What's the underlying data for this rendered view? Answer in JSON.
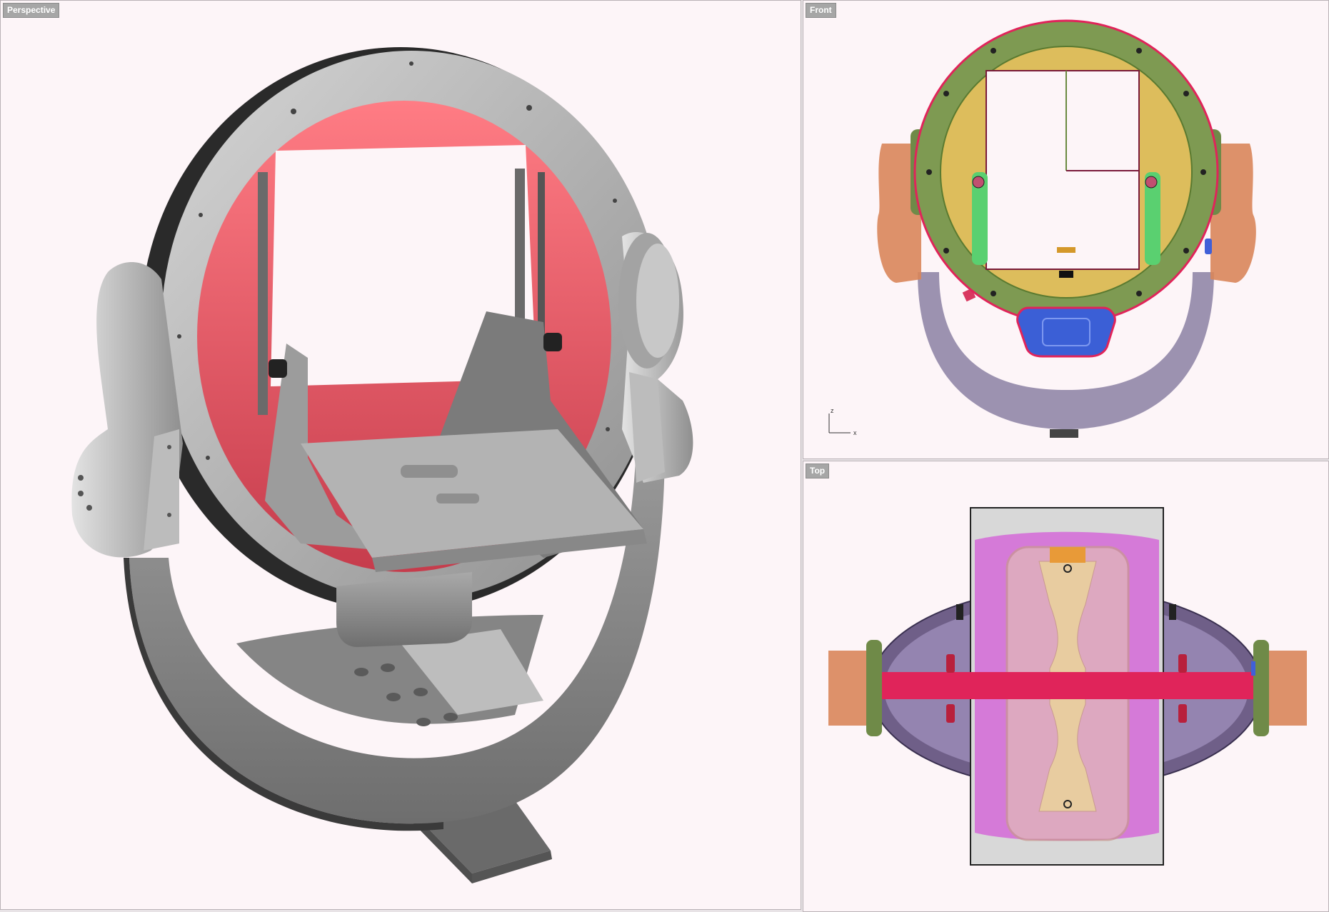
{
  "viewports": {
    "perspective": {
      "label": "Perspective"
    },
    "front": {
      "label": "Front",
      "axis": {
        "up": "z",
        "right": "x"
      }
    },
    "top": {
      "label": "Top"
    }
  },
  "colors": {
    "background": "#fdf5f8",
    "label_bg": "#a6a6a6",
    "ring_red": "#f06470",
    "metal_gray": "#b4b4b4",
    "ring_green": "#7e9a52",
    "ring_yellow": "#ddbd5c",
    "seat_blue": "#3b5fd6",
    "handle_orange": "#d9865a",
    "top_magenta": "#d570d8",
    "bar_crimson": "#e0245a",
    "base_purple": "#8a7a9c"
  }
}
